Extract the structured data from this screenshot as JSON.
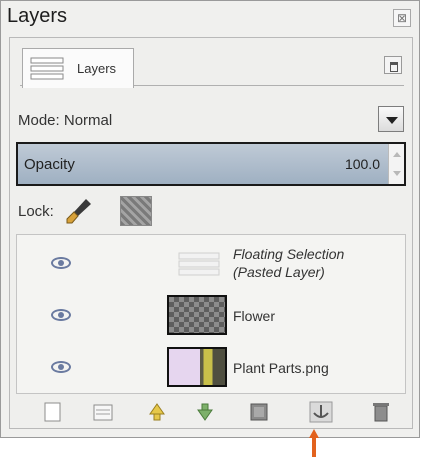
{
  "window": {
    "title": "Layers",
    "close_icon": "close-icon"
  },
  "tab": {
    "label": "Layers",
    "icon": "layers-tab-icon",
    "menu_icon": "tab-menu-icon"
  },
  "mode": {
    "label": "Mode:",
    "value": "Normal"
  },
  "opacity": {
    "label": "Opacity",
    "value": "100.0",
    "level_percent": 100
  },
  "lock": {
    "label": "Lock:",
    "icons": [
      "lock-pixels-brush-icon",
      "lock-alpha-icon"
    ]
  },
  "layers": [
    {
      "name_line1": "Floating Selection",
      "name_line2": "(Pasted Layer)",
      "visible": true,
      "thumb": "floating-selection-thumbnail"
    },
    {
      "name": "Flower",
      "visible": true,
      "thumb": "transparent-checker-thumbnail"
    },
    {
      "name": "Plant Parts.png",
      "visible": true,
      "thumb": "plant-parts-thumbnail"
    }
  ],
  "bottom_buttons": [
    "new-layer-icon",
    "new-layer-group-icon",
    "raise-layer-icon",
    "lower-layer-icon",
    "duplicate-layer-icon",
    "anchor-layer-icon",
    "delete-layer-icon"
  ],
  "colors": {
    "accent_pointer": "#e2621e",
    "opacity_fill": "#aebccb"
  }
}
